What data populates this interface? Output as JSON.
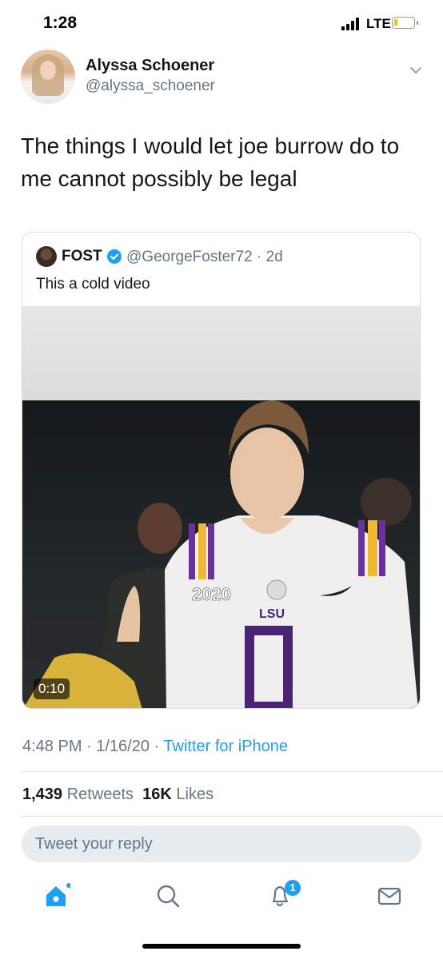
{
  "status_bar": {
    "time": "1:28",
    "network": "LTE"
  },
  "tweet": {
    "display_name": "Alyssa Schoener",
    "handle": "@alyssa_schoener",
    "text": "The things I would let joe burrow do to me cannot possibly be legal",
    "timestamp": "4:48 PM · 1/16/20 · ",
    "source": "Twitter for iPhone"
  },
  "quoted_tweet": {
    "display_name": "FOST",
    "handle": "@GeorgeFoster72 · 2d",
    "text": "This a cold video",
    "video_duration": "0:10"
  },
  "stats": {
    "retweets_count": "1,439",
    "retweets_label": "Retweets",
    "likes_count": "16K",
    "likes_label": "Likes"
  },
  "reply": {
    "placeholder": "Tweet your reply"
  },
  "tab_bar": {
    "notifications_badge": "1"
  },
  "colors": {
    "accent": "#1da1f2",
    "secondary_text": "#657786",
    "divider": "#e1e8ed"
  },
  "icons": [
    "home-icon",
    "search-icon",
    "notifications-icon",
    "messages-icon",
    "chevron-down-icon",
    "verified-icon"
  ]
}
